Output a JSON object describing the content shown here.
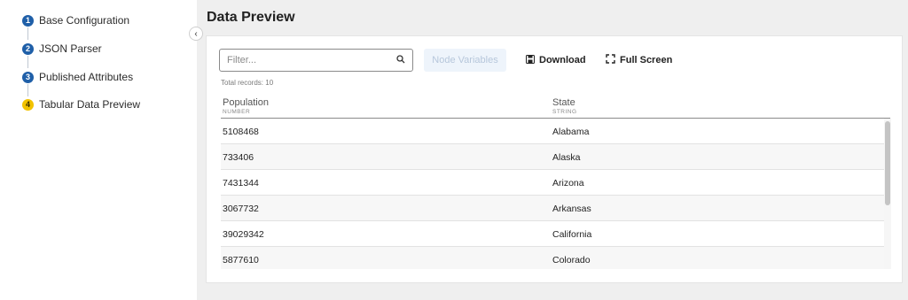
{
  "steps": [
    {
      "num": "1",
      "label": "Base Configuration",
      "state": "done"
    },
    {
      "num": "2",
      "label": "JSON Parser",
      "state": "done"
    },
    {
      "num": "3",
      "label": "Published Attributes",
      "state": "done"
    },
    {
      "num": "4",
      "label": "Tabular Data Preview",
      "state": "active"
    }
  ],
  "header": {
    "title": "Data Preview",
    "collapse_icon": "chevron-left-icon"
  },
  "toolbar": {
    "filter_placeholder": "Filter...",
    "filter_value": "",
    "node_variables_label": "Node Variables",
    "download_label": "Download",
    "fullscreen_label": "Full Screen"
  },
  "table": {
    "total_records": "Total records: 10",
    "columns": [
      {
        "name": "Population",
        "type": "NUMBER"
      },
      {
        "name": "State",
        "type": "STRING"
      }
    ],
    "rows": [
      [
        "5108468",
        "Alabama"
      ],
      [
        "733406",
        "Alaska"
      ],
      [
        "7431344",
        "Arizona"
      ],
      [
        "3067732",
        "Arkansas"
      ],
      [
        "39029342",
        "California"
      ],
      [
        "5877610",
        "Colorado"
      ]
    ]
  },
  "colors": {
    "step_done": "#1f5fa8",
    "step_active": "#f2c200",
    "main_bg": "#efefef"
  }
}
